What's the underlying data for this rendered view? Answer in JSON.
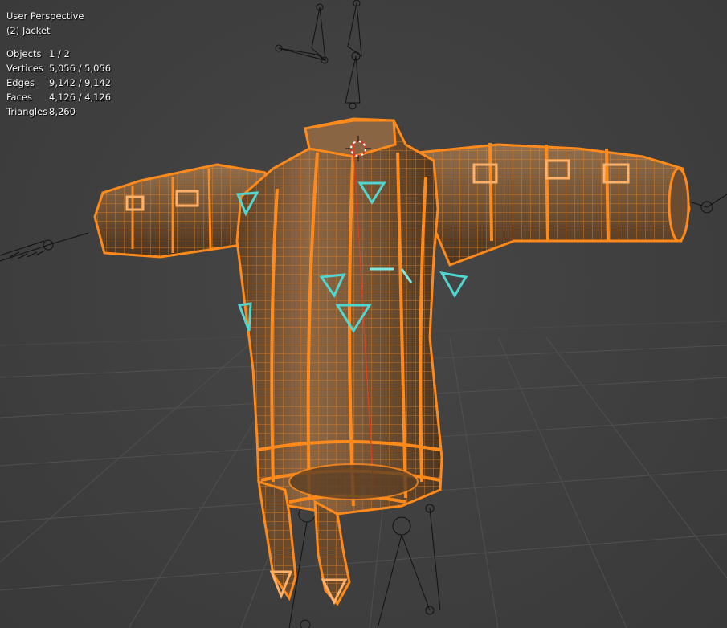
{
  "viewport": {
    "view_name": "User Perspective",
    "active_object": "(2) Jacket"
  },
  "stats": [
    {
      "label": "Objects",
      "value": "1 / 2"
    },
    {
      "label": "Vertices",
      "value": "5,056 / 5,056"
    },
    {
      "label": "Edges",
      "value": "9,142 / 9,142"
    },
    {
      "label": "Faces",
      "value": "4,126 / 4,126"
    },
    {
      "label": "Triangles",
      "value": "8,260"
    }
  ],
  "colors": {
    "background": "#3d3d3d",
    "grid": "#505050",
    "wire_selected": "#ff8a1c",
    "vertex": "#ff7a00",
    "mesh_fill": "#7a5838",
    "pin_marker": "#4fd6d0",
    "armature": "#111111"
  }
}
